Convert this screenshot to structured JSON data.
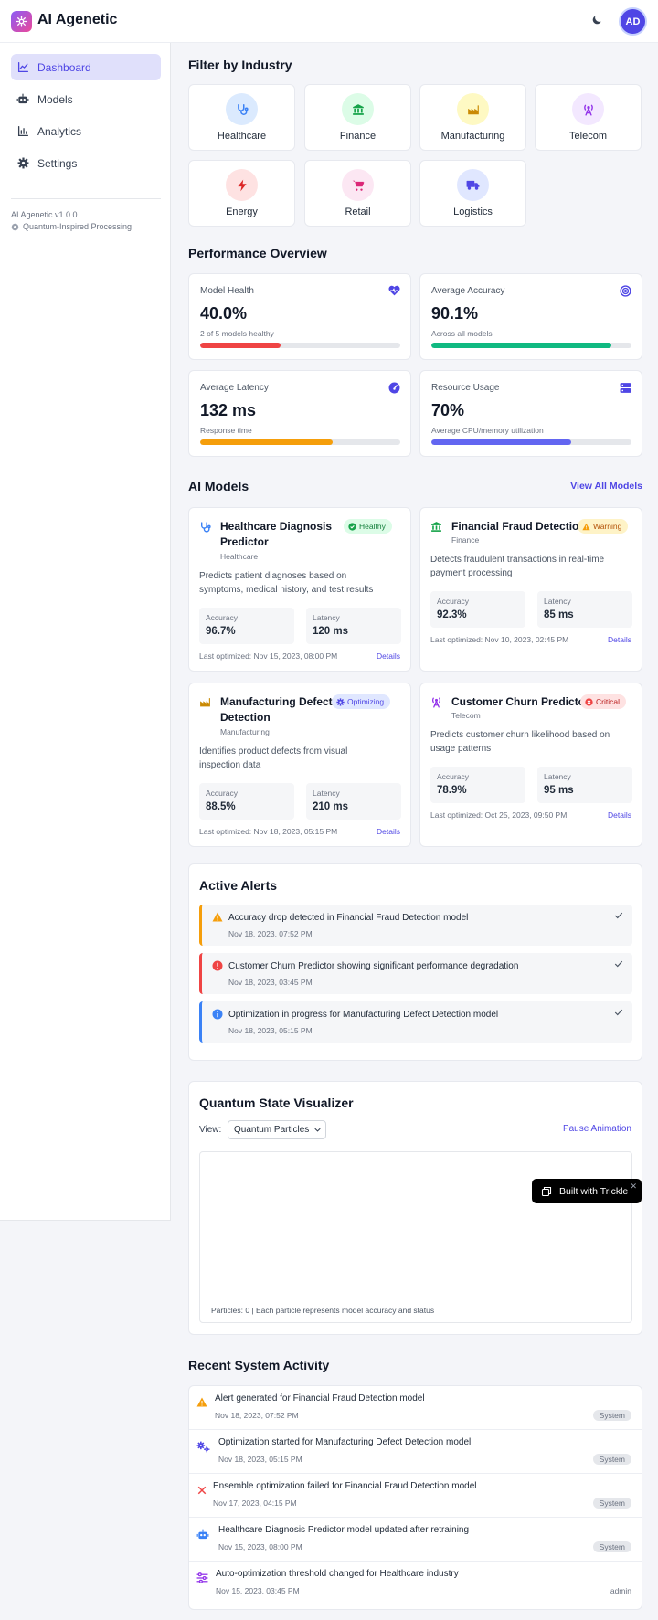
{
  "app": {
    "title": "AI Agenetic",
    "avatar_initials": "AD"
  },
  "sidebar": {
    "items": [
      {
        "label": "Dashboard",
        "icon": "chart-line-icon",
        "active": true
      },
      {
        "label": "Models",
        "icon": "robot-icon"
      },
      {
        "label": "Analytics",
        "icon": "bar-chart-icon"
      },
      {
        "label": "Settings",
        "icon": "gear-icon"
      }
    ],
    "version": "AI Agenetic v1.0.0",
    "tagline": "Quantum-Inspired Processing"
  },
  "filter": {
    "title": "Filter by Industry",
    "industries": [
      {
        "label": "Healthcare",
        "icon": "stethoscope-icon",
        "color": "#3b82f6"
      },
      {
        "label": "Finance",
        "icon": "bank-icon",
        "color": "#16a34a"
      },
      {
        "label": "Manufacturing",
        "icon": "factory-icon",
        "color": "#ca8a04"
      },
      {
        "label": "Telecom",
        "icon": "antenna-icon",
        "color": "#9333ea"
      },
      {
        "label": "Energy",
        "icon": "bolt-icon",
        "color": "#dc2626"
      },
      {
        "label": "Retail",
        "icon": "cart-icon",
        "color": "#db2777"
      },
      {
        "label": "Logistics",
        "icon": "truck-icon",
        "color": "#4f46e5"
      }
    ]
  },
  "performance": {
    "title": "Performance Overview",
    "cards": [
      {
        "label": "Model Health",
        "value": "40.0%",
        "sub": "2 of 5 models healthy",
        "progress": 0.4,
        "color": "#ef4444",
        "icon": "heartbeat-icon"
      },
      {
        "label": "Average Accuracy",
        "value": "90.1%",
        "sub": "Across all models",
        "progress": 0.901,
        "color": "#10b981",
        "icon": "target-icon"
      },
      {
        "label": "Average Latency",
        "value": "132 ms",
        "sub": "Response time",
        "progress": 0.66,
        "color": "#f59e0b",
        "icon": "gauge-icon"
      },
      {
        "label": "Resource Usage",
        "value": "70%",
        "sub": "Average CPU/memory utilization",
        "progress": 0.7,
        "color": "#6366f1",
        "icon": "server-icon"
      }
    ]
  },
  "models": {
    "title": "AI Models",
    "view_all": "View All Models",
    "accuracy_label": "Accuracy",
    "latency_label": "Latency",
    "details_label": "Details",
    "cards": [
      {
        "name_line1": "Healthcare Diagnosis",
        "name_line2": "Predictor",
        "industry": "Healthcare",
        "status": "Healthy",
        "desc1": "Predicts patient diagnoses based on",
        "desc2": "symptoms, medical history, and test results",
        "accuracy": "96.7%",
        "latency": "120 ms",
        "optimized": "Last optimized: Nov 15, 2023, 08:00 PM"
      },
      {
        "name_line1": "Financial Fraud Detection",
        "name_line2": "",
        "industry": "Finance",
        "status": "Warning",
        "desc1": "Detects fraudulent transactions in real-time",
        "desc2": "payment processing",
        "accuracy": "92.3%",
        "latency": "85 ms",
        "optimized": "Last optimized: Nov 10, 2023, 02:45 PM"
      },
      {
        "name_line1": "Manufacturing Defect",
        "name_line2": "Detection",
        "industry": "Manufacturing",
        "status": "Optimizing",
        "desc1": "Identifies product defects from visual",
        "desc2": "inspection data",
        "accuracy": "88.5%",
        "latency": "210 ms",
        "optimized": "Last optimized: Nov 18, 2023, 05:15 PM"
      },
      {
        "name_line1": "Customer Churn Predictor",
        "name_line2": "",
        "industry": "Telecom",
        "status": "Critical",
        "desc1": "Predicts customer churn likelihood based on",
        "desc2": "usage patterns",
        "accuracy": "78.9%",
        "latency": "95 ms",
        "optimized": "Last optimized: Oct 25, 2023, 09:50 PM"
      }
    ]
  },
  "alerts": {
    "title": "Active Alerts",
    "items": [
      {
        "text": "Accuracy drop detected in Financial Fraud Detection model",
        "date": "Nov 18, 2023, 07:52 PM",
        "type": "warning",
        "color": "#f59e0b"
      },
      {
        "text": "Customer Churn Predictor showing significant performance degradation",
        "date": "Nov 18, 2023, 03:45 PM",
        "type": "error",
        "color": "#ef4444"
      },
      {
        "text": "Optimization in progress for Manufacturing Defect Detection model",
        "date": "Nov 18, 2023, 05:15 PM",
        "type": "info",
        "color": "#3b82f6"
      }
    ]
  },
  "quantum": {
    "title": "Quantum State Visualizer",
    "view_label": "View:",
    "selected_view": "Quantum Particles",
    "pause": "Pause Animation",
    "caption": "Particles: 0 | Each particle represents model accuracy and status"
  },
  "trickle": {
    "label": "Built with Trickle"
  },
  "activity": {
    "title": "Recent System Activity",
    "items": [
      {
        "text": "Alert generated for Financial Fraud Detection model",
        "date": "Nov 18, 2023, 07:52 PM",
        "tag": "System",
        "icon": "warning-icon"
      },
      {
        "text": "Optimization started for Manufacturing Defect Detection model",
        "date": "Nov 18, 2023, 05:15 PM",
        "tag": "System",
        "icon": "gears-icon"
      },
      {
        "text": "Ensemble optimization failed for Financial Fraud Detection model",
        "date": "Nov 17, 2023, 04:15 PM",
        "tag": "System",
        "icon": "x-icon"
      },
      {
        "text": "Healthcare Diagnosis Predictor model updated after retraining",
        "date": "Nov 15, 2023, 08:00 PM",
        "tag": "System",
        "icon": "robot-icon"
      },
      {
        "text": "Auto-optimization threshold changed for Healthcare industry",
        "date": "Nov 15, 2023, 03:45 PM",
        "tag": "admin",
        "icon": "sliders-icon"
      }
    ]
  }
}
